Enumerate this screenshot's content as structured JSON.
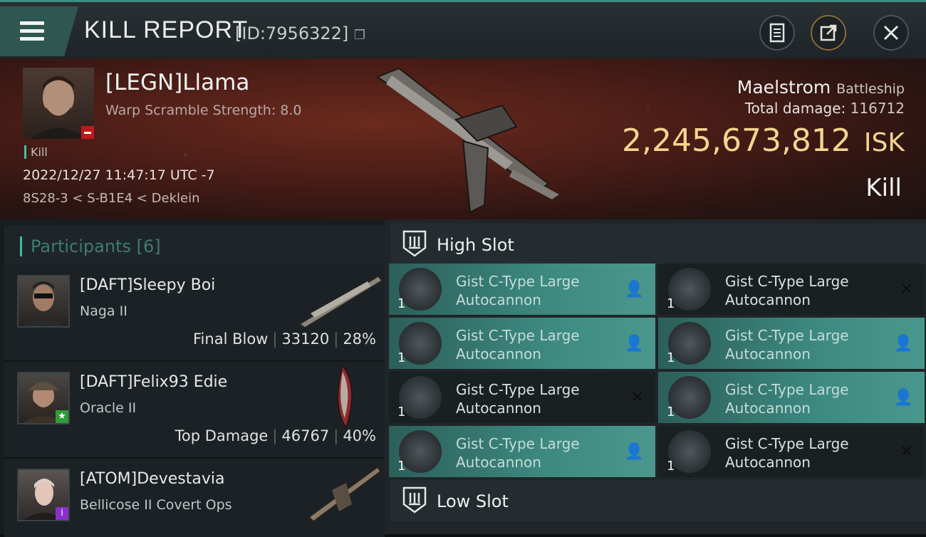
{
  "header": {
    "title": "KILL REPORT",
    "report_id": "[ID:7956322]",
    "icons": [
      "menu-icon",
      "clipboard-icon",
      "share-icon",
      "close-icon"
    ]
  },
  "victim": {
    "name": "[LEGN]Llama",
    "warp_scramble": "Warp Scramble Strength: 8.0",
    "kill_tag": "Kill",
    "datetime": "2022/12/27 11:47:17 UTC -7",
    "location": "8S28-3 < S-B1E4 < Deklein",
    "ship": "Maelstrom",
    "ship_class": "Battleship",
    "total_damage_label": "Total damage:",
    "total_damage": "116712",
    "isk_value": "2,245,673,812",
    "isk_unit": "ISK",
    "result": "Kill"
  },
  "participants": {
    "label": "Participants",
    "count": "[6]",
    "rows": [
      {
        "name": "[DAFT]Sleepy Boi",
        "ship": "Naga II",
        "tag": "Final Blow",
        "damage": "33120",
        "percent": "28%"
      },
      {
        "name": "[DAFT]Felix93 Edie",
        "ship": "Oracle II",
        "tag": "Top Damage",
        "damage": "46767",
        "percent": "40%"
      },
      {
        "name": "[ATOM]Devestavia",
        "ship": "Bellicose II Covert Ops",
        "tag": "",
        "damage": "",
        "percent": ""
      }
    ]
  },
  "slots": {
    "high_label": "High Slot",
    "low_label": "Low Slot",
    "module_line1": "Gist C-Type Large",
    "module_line2": "Autocannon",
    "qty": "1",
    "status_fitted": "👤",
    "status_destroyed": "✕"
  },
  "colors": {
    "accent": "#43b6a4",
    "isk": "#f4d58f",
    "fitted": "#3d8a81"
  }
}
